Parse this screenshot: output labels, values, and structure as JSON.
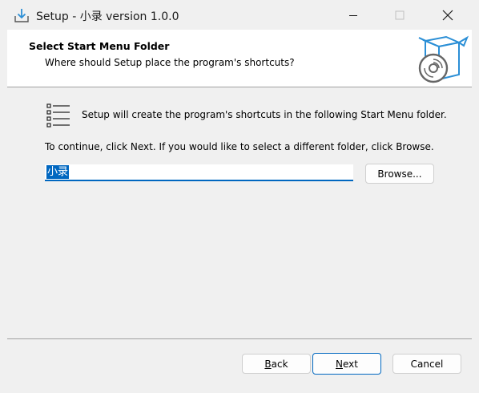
{
  "window": {
    "title": "Setup - 小录 version 1.0.0"
  },
  "header": {
    "title": "Select Start Menu Folder",
    "subtitle": "Where should Setup place the program's shortcuts?",
    "icon": "setup-box-disc-icon"
  },
  "content": {
    "info": "Setup will create the program's shortcuts in the following Start Menu folder.",
    "instruction": "To continue, click Next. If you would like to select a different folder, click Browse.",
    "folder_value": "小录",
    "browse_label": "Browse..."
  },
  "footer": {
    "back_first": "B",
    "back_rest": "ack",
    "next_first": "N",
    "next_rest": "ext",
    "cancel_label": "Cancel"
  },
  "colors": {
    "accent": "#0067c0",
    "icon_blue": "#2b8fd6"
  }
}
